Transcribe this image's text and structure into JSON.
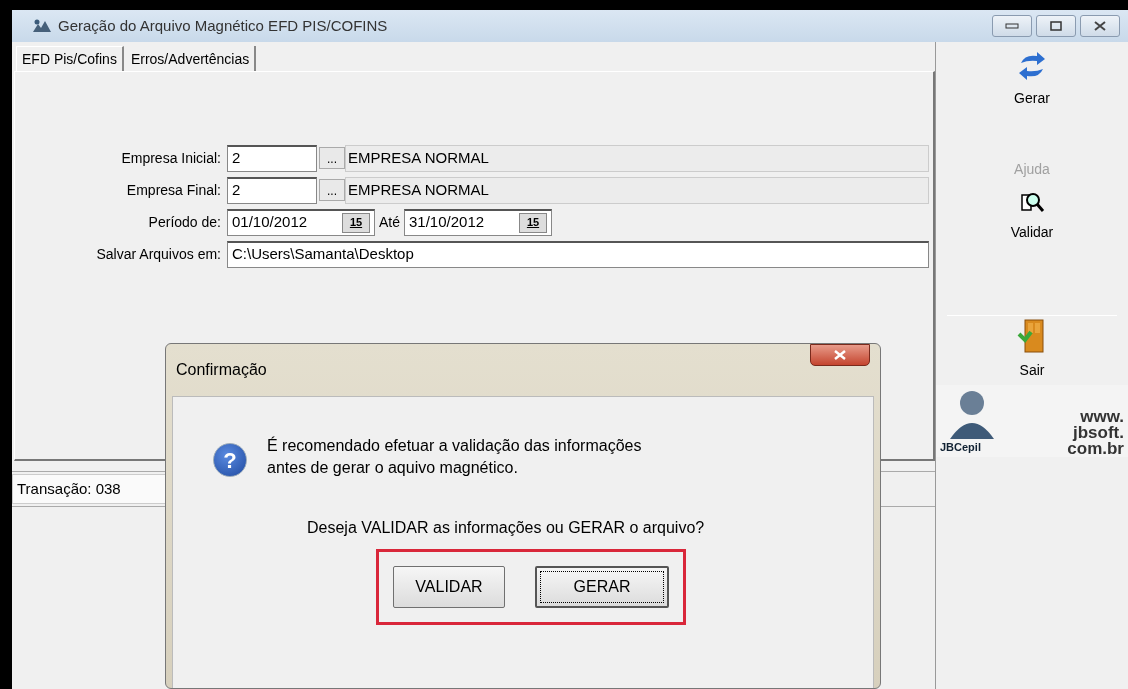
{
  "window": {
    "title": "Geração do Arquivo Magnético  EFD PIS/COFINS"
  },
  "tabs": [
    {
      "label": "EFD Pis/Cofins",
      "selected": true
    },
    {
      "label": "Erros/Advertências",
      "selected": false
    }
  ],
  "fields": [
    {
      "kind": "company",
      "label": "Empresa Inicial:",
      "code": "2",
      "button": "...",
      "name": "EMPRESA NORMAL"
    },
    {
      "kind": "company",
      "label": "Empresa Final:",
      "code": "2",
      "button": "...",
      "name": "EMPRESA NORMAL"
    },
    {
      "kind": "period",
      "label": "Período de:",
      "from": "01/10/2012",
      "to_label": "Até",
      "from_calendar": "15",
      "to": "31/10/2012",
      "to_calendar": "15"
    },
    {
      "kind": "path",
      "label": "Salvar Arquivos em:",
      "value": "C:\\Users\\Samanta\\Desktop"
    }
  ],
  "toolbar": [
    {
      "kind": "refresh",
      "label": "Gerar",
      "disabled": false
    },
    {
      "kind": "text",
      "label": "Ajuda",
      "disabled": true
    },
    {
      "kind": "validate",
      "label": "Validar",
      "disabled": false
    },
    {
      "kind": "exit",
      "label": "Sair",
      "disabled": false
    }
  ],
  "logo": {
    "lines": [
      "www.",
      "jbsoft.",
      "com.br"
    ],
    "brand": "JBCepil"
  },
  "status_bar": {
    "text": "Transação: 038"
  },
  "dialog": {
    "title": "Confirmação",
    "icon": "?",
    "message": "É recomendado efetuar a validação das informações antes de gerar o aquivo magnético.",
    "question": "Deseja VALIDAR as informações  ou GERAR o arquivo?",
    "highlight": true,
    "buttons": [
      {
        "label": "VALIDAR",
        "focused": false
      },
      {
        "label": "GERAR",
        "focused": true
      }
    ]
  }
}
